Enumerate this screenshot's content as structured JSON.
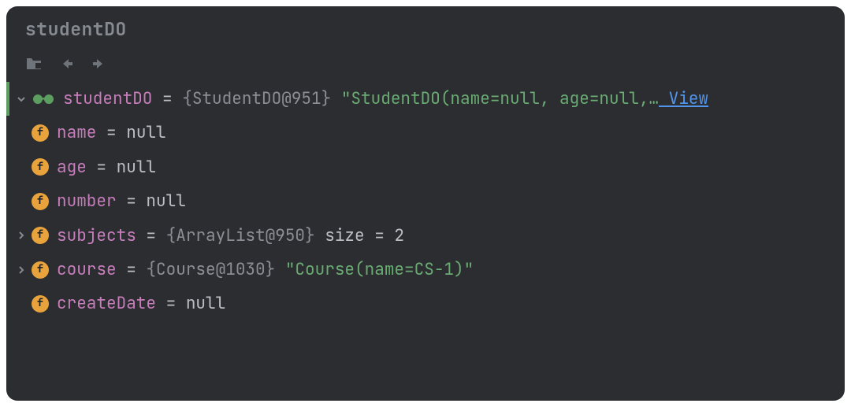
{
  "title": "studentDO",
  "root": {
    "name": "studentDO",
    "eq": " = ",
    "type": "{StudentDO@951}",
    "str": " \"StudentDO(name=null, age=null,…",
    "view_link": " View"
  },
  "fields": [
    {
      "expand": "",
      "name": "name",
      "eq": " = ",
      "type": "",
      "str": "",
      "null": "null"
    },
    {
      "expand": "",
      "name": "age",
      "eq": " = ",
      "type": "",
      "str": "",
      "null": "null"
    },
    {
      "expand": "",
      "name": "number",
      "eq": " = ",
      "type": "",
      "str": "",
      "null": "null"
    },
    {
      "expand": ">",
      "name": "subjects",
      "eq": " = ",
      "type": "{ArrayList@950} ",
      "str": "",
      "null": " size = 2"
    },
    {
      "expand": ">",
      "name": "course",
      "eq": " = ",
      "type": "{Course@1030}",
      "str": " \"Course(name=CS-1)\"",
      "null": ""
    },
    {
      "expand": "",
      "name": "createDate",
      "eq": " = ",
      "type": "",
      "str": "",
      "null": "null"
    }
  ],
  "icons": {
    "field_letter": "f"
  }
}
